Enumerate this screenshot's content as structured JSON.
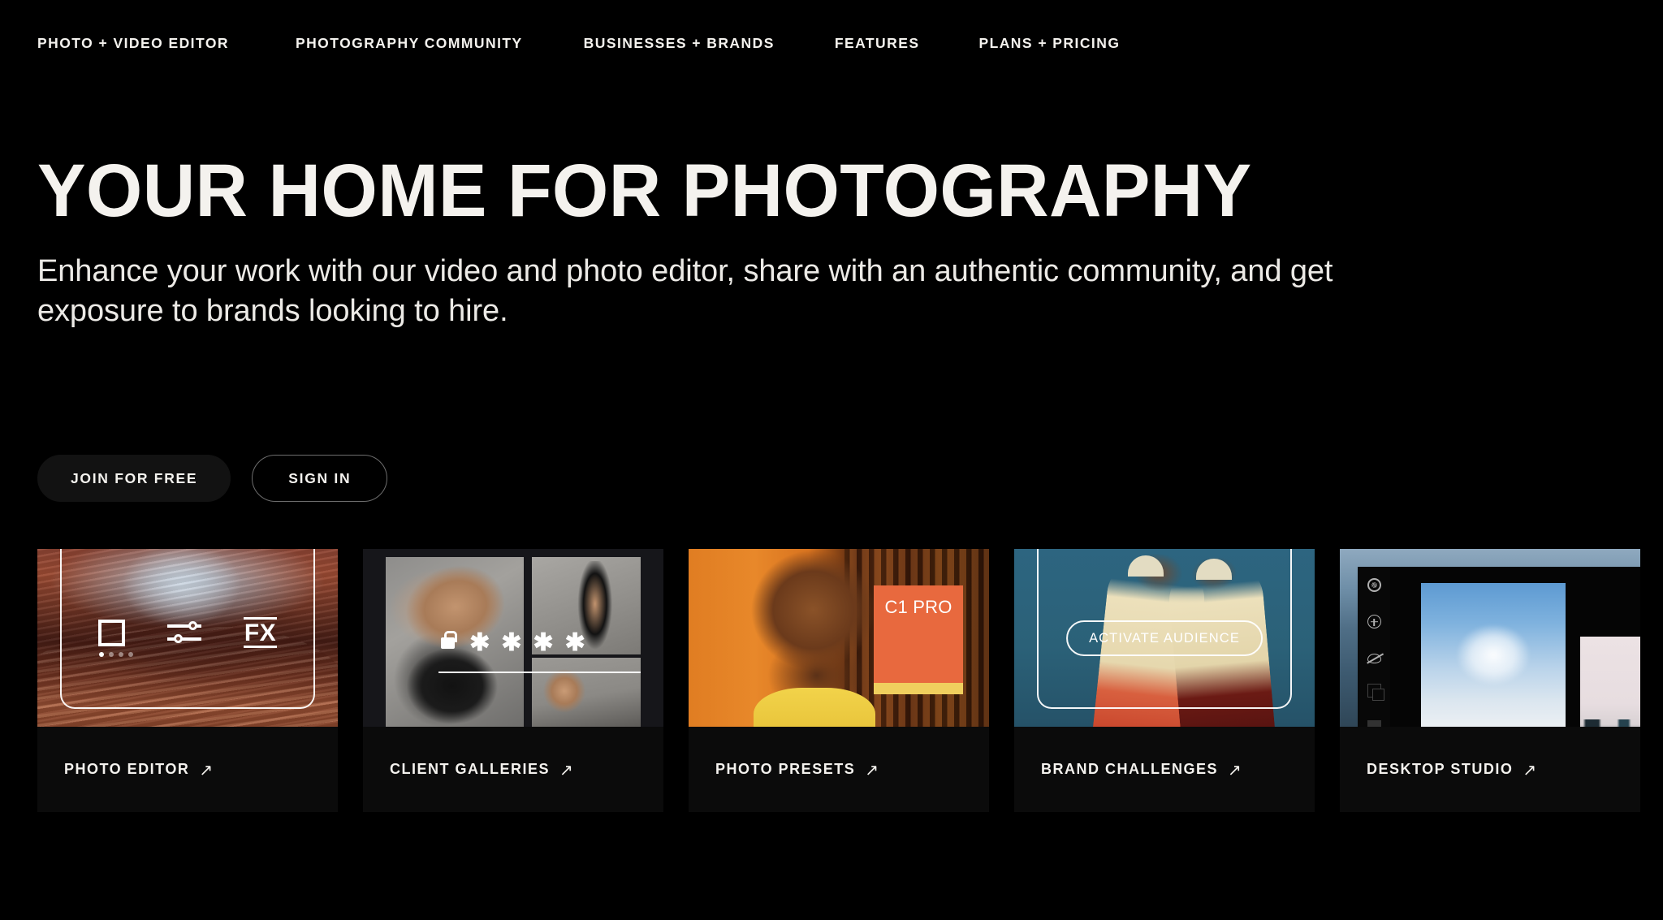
{
  "nav": {
    "items": [
      {
        "label": "PHOTO + VIDEO EDITOR"
      },
      {
        "label": "PHOTOGRAPHY COMMUNITY"
      },
      {
        "label": "BUSINESSES + BRANDS"
      },
      {
        "label": "FEATURES"
      },
      {
        "label": "PLANS + PRICING"
      }
    ]
  },
  "hero": {
    "title": "YOUR HOME FOR PHOTOGRAPHY",
    "subtitle": "Enhance your work with our video and photo editor, share with an authentic community, and get exposure to brands looking to hire."
  },
  "cta": {
    "primary_label": "JOIN FOR FREE",
    "secondary_label": "SIGN IN"
  },
  "cards": [
    {
      "label": "PHOTO EDITOR",
      "arrow": "↗",
      "overlay": {
        "fx_label": "FX",
        "icons": [
          "crop-icon",
          "sliders-icon",
          "fx-icon"
        ]
      }
    },
    {
      "label": "CLIENT GALLERIES",
      "arrow": "↗",
      "overlay": {
        "password_mask": "✱ ✱ ✱ ✱",
        "icons": [
          "lock-icon"
        ]
      }
    },
    {
      "label": "PHOTO PRESETS",
      "arrow": "↗",
      "overlay": {
        "preset_name": "C1 PRO",
        "chip_color": "#e8693e",
        "strip_color": "#f0cf5e"
      }
    },
    {
      "label": "BRAND CHALLENGES",
      "arrow": "↗",
      "overlay": {
        "button_label": "ACTIVATE AUDIENCE"
      }
    },
    {
      "label": "DESKTOP STUDIO",
      "arrow": "↗",
      "overlay": {
        "icons": [
          "aperture-icon",
          "plus-circle-icon",
          "eye-off-icon",
          "layers-icon",
          "copy-icon"
        ]
      }
    }
  ],
  "theme": {
    "background": "#000000",
    "text": "#f4f2ee",
    "card_background": "#0b0b0b",
    "button_primary_bg": "#121212",
    "button_border": "#6d6d6d"
  }
}
